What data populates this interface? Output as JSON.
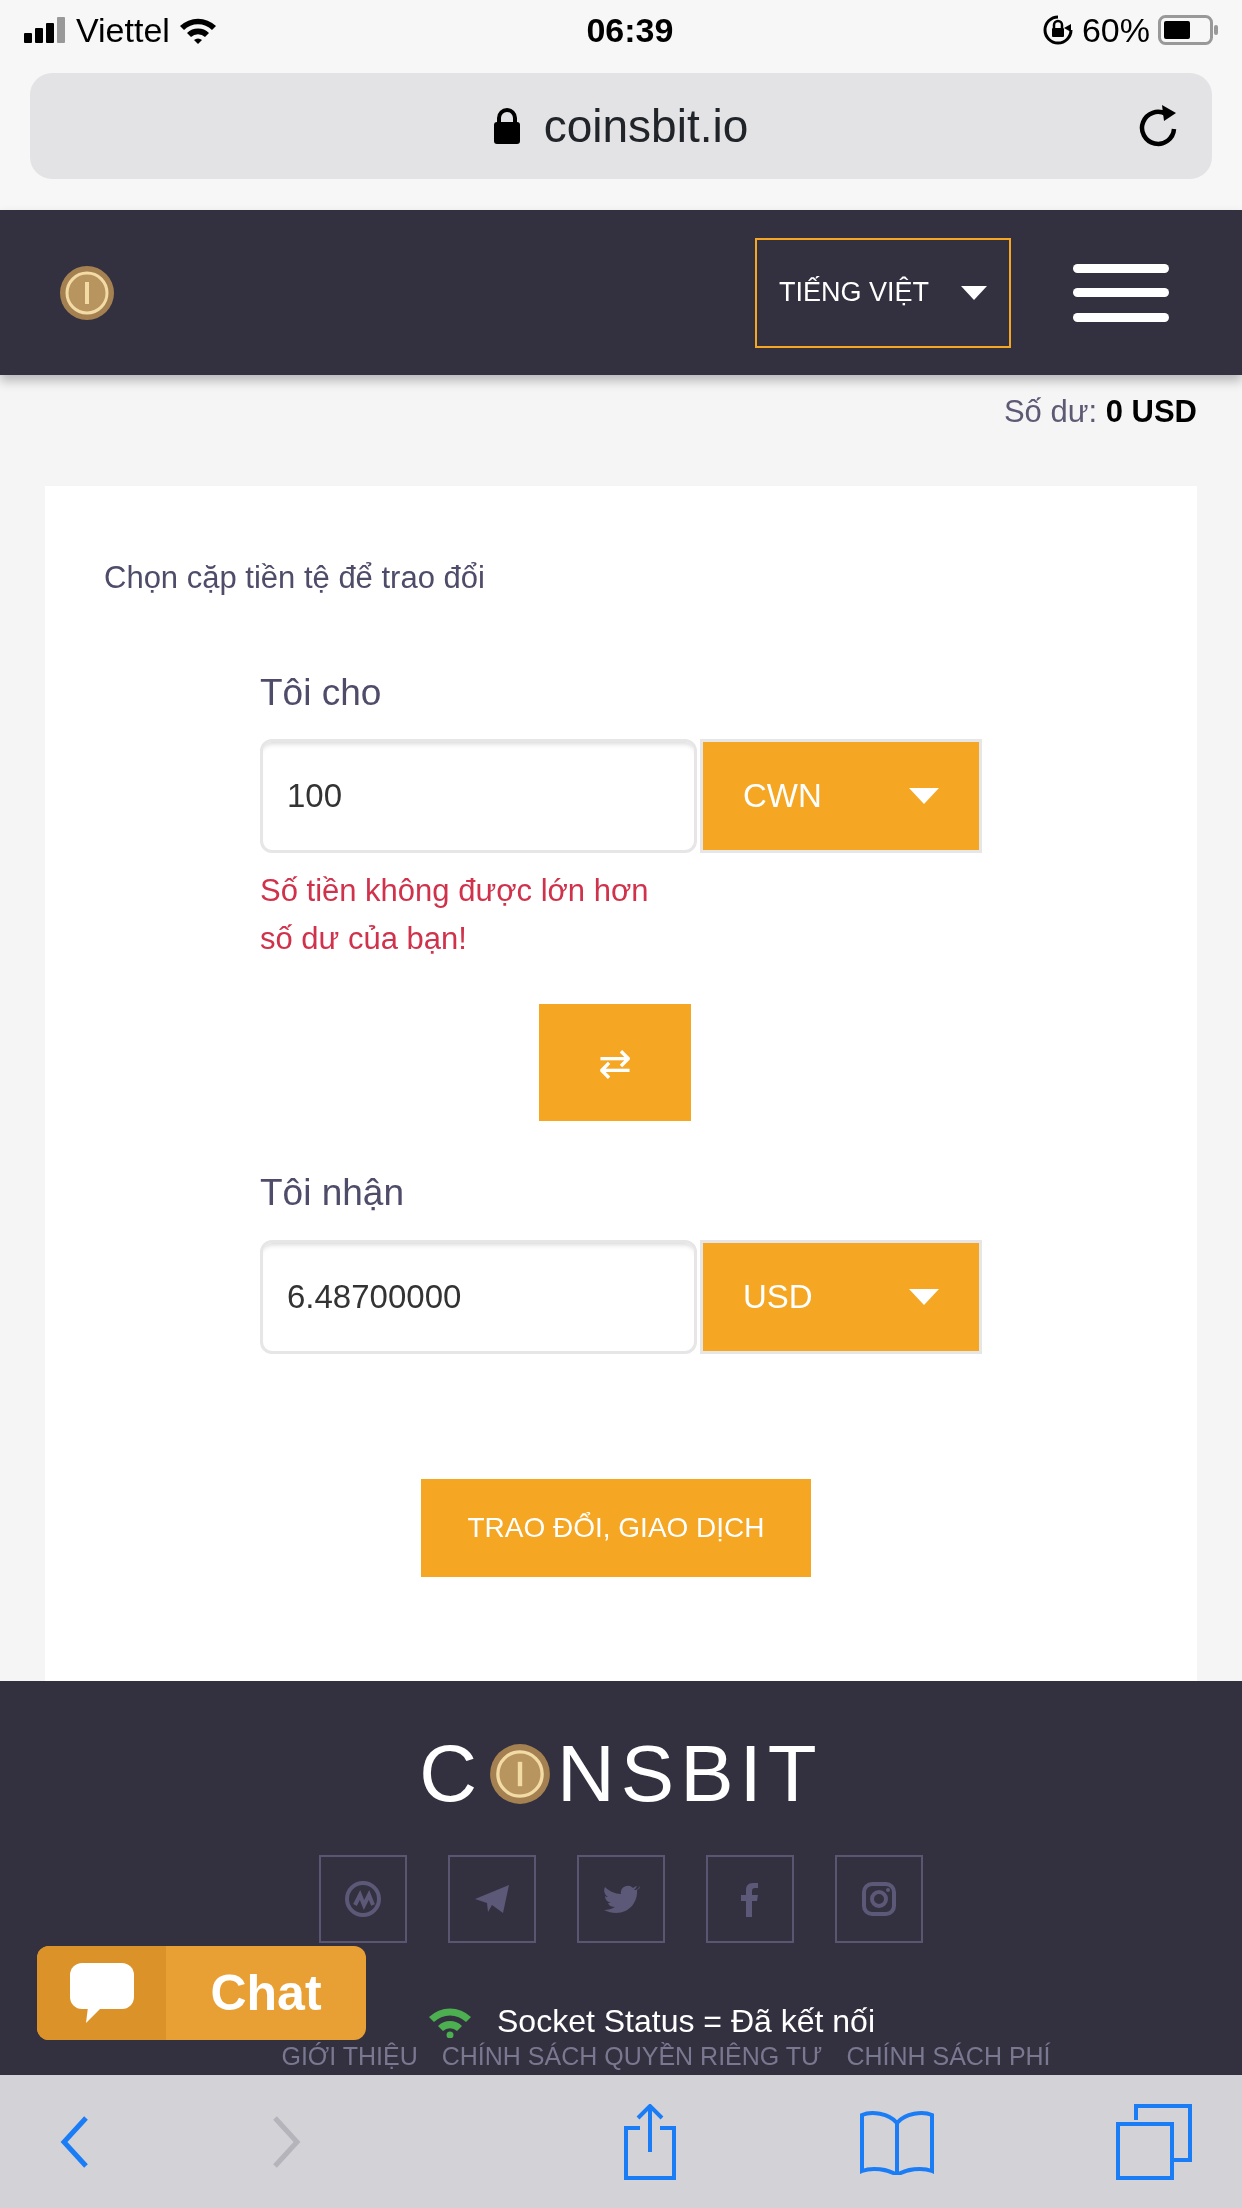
{
  "status_bar": {
    "carrier": "Viettel",
    "time": "06:39",
    "battery": "60%"
  },
  "browser": {
    "url": "coinsbit.io"
  },
  "header": {
    "language": "TIẾNG VIỆT"
  },
  "balance": {
    "label": "Số dư:",
    "value": "0 USD"
  },
  "exchange": {
    "title": "Chọn cặp tiền tệ để trao đổi",
    "give": {
      "label": "Tôi cho",
      "value": "100",
      "currency": "CWN",
      "error": "Số tiền không được lớn hơn số dư của bạn!"
    },
    "swap": "⇄",
    "receive": {
      "label": "Tôi nhận",
      "value": "6.48700000",
      "currency": "USD"
    },
    "submit": "TRAO ĐỔI, GIAO DỊCH"
  },
  "footer": {
    "logo_before": "C",
    "logo_after": "NSBIT",
    "socket_status": "Socket Status = Đã kết nối",
    "links": [
      "GIỚI THIỆU",
      "CHÍNH SÁCH QUYỀN RIÊNG TƯ",
      "CHÍNH SÁCH PHÍ"
    ]
  },
  "chat": {
    "label": "Chat"
  },
  "toolbar": [
    {
      "kind": "back",
      "disabled": false
    },
    {
      "kind": "forward",
      "disabled": true
    },
    {
      "kind": "share",
      "disabled": false
    },
    {
      "kind": "bookmarks",
      "disabled": false
    },
    {
      "kind": "tabs",
      "disabled": false
    }
  ]
}
